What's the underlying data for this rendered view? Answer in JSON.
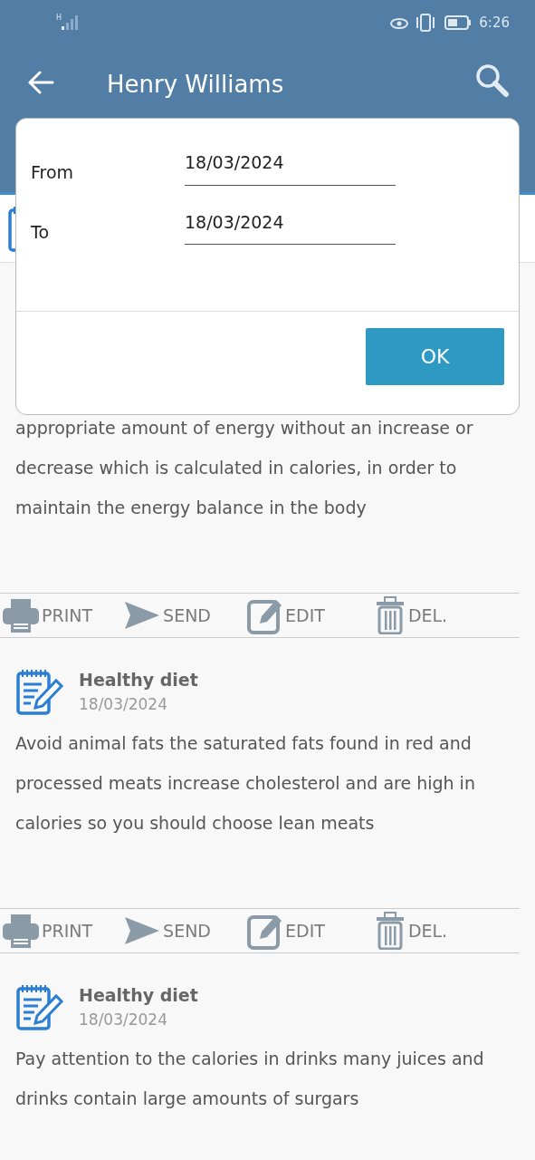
{
  "status_bar": {
    "network_type": "H",
    "time": "6:26"
  },
  "app_bar": {
    "title": "Henry Williams"
  },
  "notes": [
    {
      "text": "appropriate amount of energy without an increase or decrease which is calculated in calories, in order to maintain the energy balance in the body",
      "actions": [
        "PRINT",
        "SEND",
        "EDIT",
        "DEL."
      ]
    },
    {
      "title": "Healthy diet",
      "date": "18/03/2024",
      "text": "Avoid animal fats the saturated fats found in red and processed meats increase cholesterol and are high in calories so you should choose lean meats",
      "actions": [
        "PRINT",
        "SEND",
        "EDIT",
        "DEL."
      ]
    },
    {
      "title": "Healthy diet",
      "date": "18/03/2024",
      "text": "Pay attention to the calories in drinks many juices and drinks contain large amounts of surgars"
    }
  ],
  "dialog": {
    "fields": [
      {
        "label": "From",
        "value": "18/03/2024"
      },
      {
        "label": "To",
        "value": "18/03/2024"
      }
    ],
    "button": "OK"
  }
}
